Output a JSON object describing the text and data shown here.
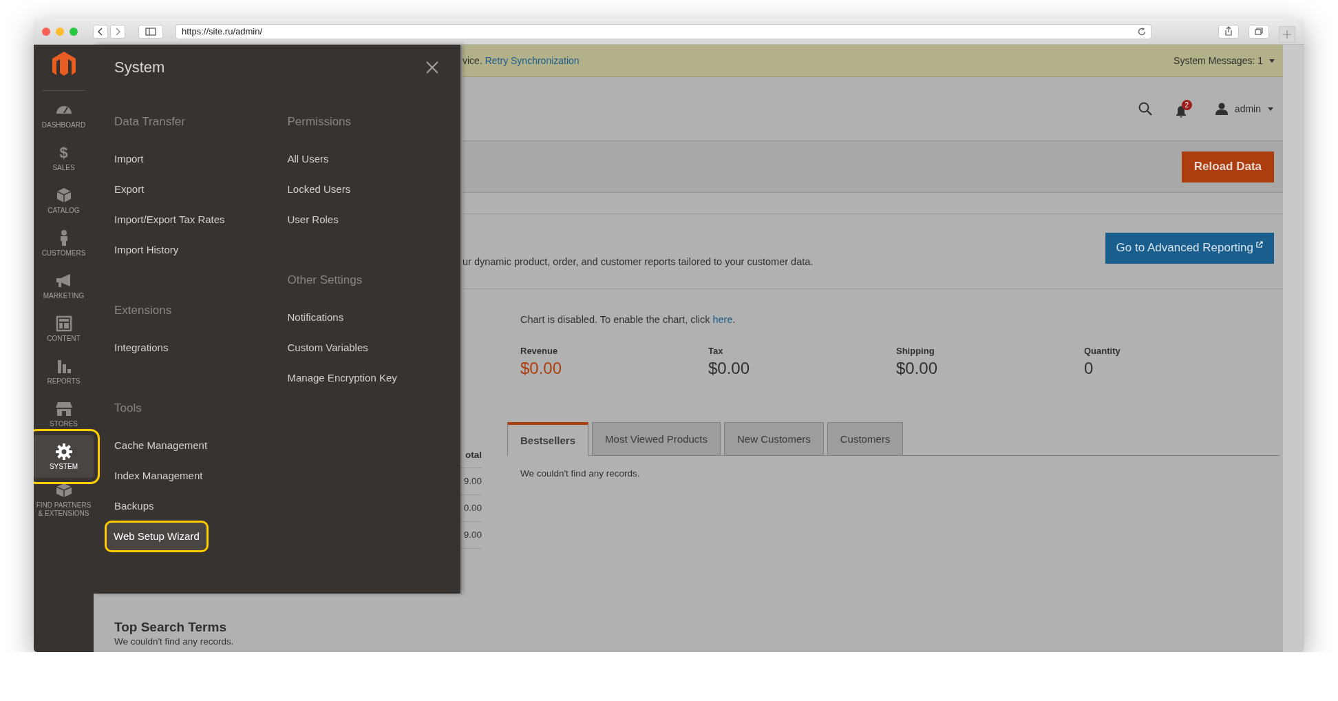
{
  "browser": {
    "url": "https://site.ru/admin/"
  },
  "sidebar": {
    "items": [
      {
        "label": "DASHBOARD",
        "kind": "gauge",
        "selected": false,
        "highlighted": false
      },
      {
        "label": "SALES",
        "kind": "dollar",
        "glyph": "$",
        "selected": false,
        "highlighted": false
      },
      {
        "label": "CATALOG",
        "kind": "box",
        "selected": false,
        "highlighted": false
      },
      {
        "label": "CUSTOMERS",
        "kind": "person",
        "selected": false,
        "highlighted": false
      },
      {
        "label": "MARKETING",
        "kind": "megaphone",
        "selected": false,
        "highlighted": false
      },
      {
        "label": "CONTENT",
        "kind": "layout",
        "selected": false,
        "highlighted": false
      },
      {
        "label": "REPORTS",
        "kind": "bars",
        "selected": false,
        "highlighted": false
      },
      {
        "label": "STORES",
        "kind": "store",
        "selected": false,
        "highlighted": false
      },
      {
        "label": "SYSTEM",
        "kind": "gear",
        "selected": true,
        "highlighted": true
      },
      {
        "label": "FIND PARTNERS & EXTENSIONS",
        "kind": "blocks",
        "selected": false,
        "highlighted": false
      }
    ]
  },
  "notice": {
    "text": "vice.",
    "link": "Retry Synchronization",
    "messages": "System Messages: 1"
  },
  "header": {
    "notifications": "2",
    "user": "admin"
  },
  "actions": {
    "reload": "Reload Data"
  },
  "advanced_reporting": {
    "text": "ur dynamic product, order, and customer reports tailored to your customer data.",
    "button": "Go to Advanced Reporting"
  },
  "chart_notice": {
    "text": "Chart is disabled. To enable the chart, click",
    "link": "here",
    "end": "."
  },
  "totals": [
    {
      "label": "Revenue",
      "value": "$0.00",
      "accent": true
    },
    {
      "label": "Tax",
      "value": "$0.00",
      "accent": false
    },
    {
      "label": "Shipping",
      "value": "$0.00",
      "accent": false
    },
    {
      "label": "Quantity",
      "value": "0",
      "accent": false
    }
  ],
  "partial_table": {
    "header": "otal",
    "rows": [
      "9.00",
      "0.00",
      "9.00"
    ]
  },
  "tabs": [
    {
      "label": "Bestsellers",
      "selected": true
    },
    {
      "label": "Most Viewed Products",
      "selected": false
    },
    {
      "label": "New Customers",
      "selected": false
    },
    {
      "label": "Customers",
      "selected": false
    }
  ],
  "tab_content": "We couldn't find any records.",
  "top_search_terms": {
    "title": "Top Search Terms",
    "empty": "We couldn't find any records."
  },
  "menu": {
    "title": "System",
    "columns": [
      [
        {
          "section": "Data Transfer",
          "items": [
            {
              "label": "Import",
              "highlighted": false
            },
            {
              "label": "Export",
              "highlighted": false
            },
            {
              "label": "Import/Export Tax Rates",
              "highlighted": false
            },
            {
              "label": "Import History",
              "highlighted": false
            }
          ]
        },
        {
          "section": "Extensions",
          "items": [
            {
              "label": "Integrations",
              "highlighted": false
            }
          ]
        },
        {
          "section": "Tools",
          "items": [
            {
              "label": "Cache Management",
              "highlighted": false
            },
            {
              "label": "Index Management",
              "highlighted": false
            },
            {
              "label": "Backups",
              "highlighted": false
            },
            {
              "label": "Web Setup Wizard",
              "highlighted": true
            }
          ]
        }
      ],
      [
        {
          "section": "Permissions",
          "items": [
            {
              "label": "All Users",
              "highlighted": false
            },
            {
              "label": "Locked Users",
              "highlighted": false
            },
            {
              "label": "User Roles",
              "highlighted": false
            }
          ]
        },
        {
          "section": "Other Settings",
          "items": [
            {
              "label": "Notifications",
              "highlighted": false
            },
            {
              "label": "Custom Variables",
              "highlighted": false
            },
            {
              "label": "Manage Encryption Key",
              "highlighted": false
            }
          ]
        }
      ]
    ]
  }
}
